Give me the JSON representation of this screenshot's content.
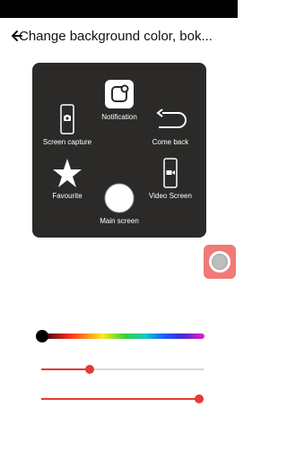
{
  "header": {
    "title": "Change background color, bok..."
  },
  "menu": {
    "items": [
      {
        "label": "Notification",
        "icon": "notification-icon"
      },
      {
        "label": "Screen capture",
        "icon": "camera-phone-icon"
      },
      {
        "label": "Come back",
        "icon": "back-arrow-icon"
      },
      {
        "label": "Favourite",
        "icon": "star-icon"
      },
      {
        "label": "Video Screen",
        "icon": "video-phone-icon"
      },
      {
        "label": "Main screen",
        "icon": "home-circle-icon"
      }
    ]
  },
  "controls": {
    "color_slider_value": 0.0,
    "slider_1_value": 0.3,
    "slider_2_value": 1.0
  },
  "colors": {
    "panel": "#2b2a28",
    "accent": "#e53935",
    "float_button": "#f07a76"
  }
}
